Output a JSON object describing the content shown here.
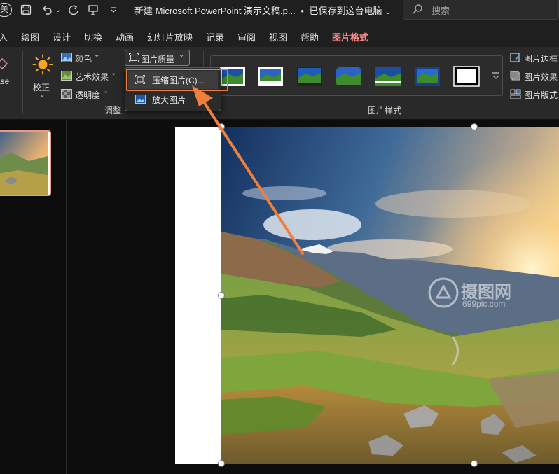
{
  "titlebar": {
    "close_badge": "关",
    "doc_title": "新建 Microsoft PowerPoint 演示文稿.p...",
    "save_status": "已保存到这台电脑",
    "search_placeholder": "搜索"
  },
  "tabs": [
    "入",
    "绘图",
    "设计",
    "切换",
    "动画",
    "幻灯片放映",
    "记录",
    "审阅",
    "视图",
    "帮助",
    "图片格式"
  ],
  "active_tab": "图片格式",
  "ribbon": {
    "remove_bg_fragment": "ase",
    "corrections": "校正",
    "color": "颜色",
    "artistic_effects": "艺术效果",
    "transparency": "透明度",
    "quality": "图片质量",
    "adjust_group": "调整",
    "styles_group": "图片样式",
    "picture_border": "图片边框",
    "picture_effects": "图片效果",
    "picture_layout": "图片版式"
  },
  "dropdown": {
    "compress": "压缩图片(C)...",
    "enlarge": "放大图片"
  },
  "watermark": {
    "name": "摄图网",
    "url": "699pic.com"
  },
  "colors": {
    "accent_tab": "#ff8a8a",
    "highlight_box": "#f07f3c",
    "arrow": "#f07f3c"
  }
}
